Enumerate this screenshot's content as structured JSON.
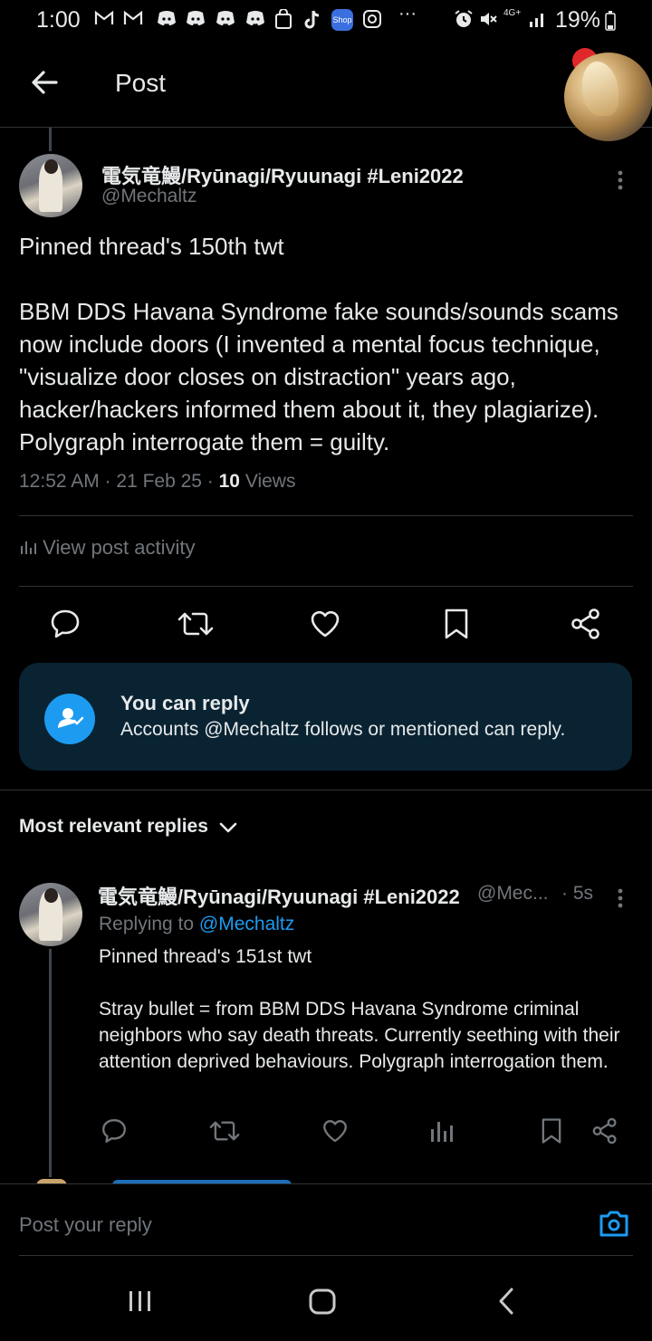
{
  "status_bar": {
    "time": "1:00",
    "icons": [
      "gmail-icon",
      "gmail-icon",
      "discord-icon",
      "discord-icon",
      "discord-icon",
      "discord-icon",
      "shopping-bag-icon",
      "tiktok-icon",
      "shop-icon",
      "instagram-icon",
      "more-dots-icon",
      "alarm-icon",
      "mute-icon",
      "4g-icon",
      "signal-icon"
    ],
    "shop_label": "Shop",
    "network": "4G+",
    "battery": "19%"
  },
  "header": {
    "title": "Post"
  },
  "post": {
    "author_name": "電気竜鰻/Ryūnagi/Ryuunagi #Leni2022",
    "handle": "@Mechaltz",
    "body_lines": [
      "Pinned thread's 150th twt",
      "BBM DDS Havana Syndrome fake sounds/sounds scams now include doors (I invented a mental focus technique, \"visualize door closes on distraction\" years ago, hacker/hackers informed them about it, they plagiarize). Polygraph interrogate them = guilty."
    ],
    "meta_time": "12:52 AM · 21 Feb 25 · ",
    "views_count": "10",
    "views_label": " Views",
    "activity_label": "View post activity"
  },
  "actions": {
    "icons": [
      "reply-icon",
      "repost-icon",
      "like-icon",
      "bookmark-icon",
      "share-icon"
    ]
  },
  "reply_restriction": {
    "title": "You can reply",
    "text": "Accounts @Mechaltz follows or mentioned can reply."
  },
  "replies": {
    "sort_label": "Most relevant replies",
    "items": [
      {
        "author_name": "電気竜鰻/Ryūnagi/Ryuunagi #Leni2022",
        "handle": "@Mec...",
        "time": "· 5s",
        "replying_prefix": "Replying to ",
        "replying_handle": "@Mechaltz",
        "body_lines": [
          "Pinned thread's 151st twt",
          "Stray bullet = from BBM DDS Havana Syndrome criminal neighbors who say death threats. Currently seething with their attention deprived behaviours. Polygraph interrogation them."
        ]
      }
    ]
  },
  "composer": {
    "placeholder": "Post your reply"
  },
  "colors": {
    "accent": "#1d9bf0",
    "background": "#000000",
    "muted": "#71767b",
    "reply_box": "#092332"
  }
}
